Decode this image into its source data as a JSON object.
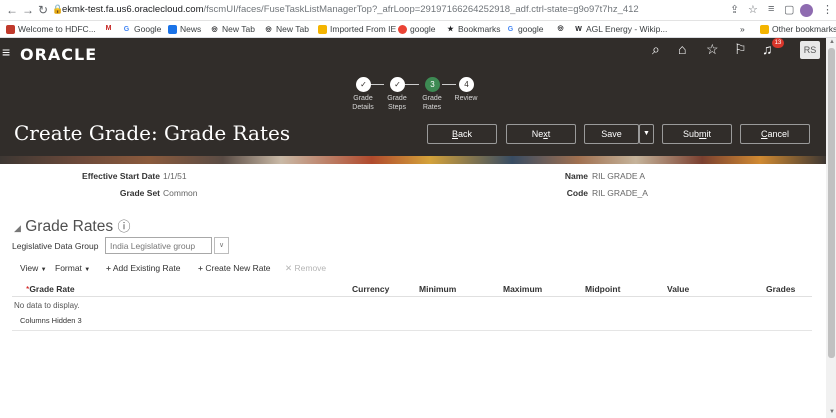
{
  "browser": {
    "url_host": "ekmk-test.fa.us6.oraclecloud.com",
    "url_path": "/fscmUI/faces/FuseTaskListManagerTop?_afrLoop=29197166264252918_adf.ctrl-state=g9o97t7hz_412",
    "bookmarks": [
      {
        "label": "Welcome to HDFC...",
        "icon_color": "#c0392b",
        "glyph": "■"
      },
      {
        "label": "",
        "icon_color": "#c5221f",
        "glyph": "M"
      },
      {
        "label": "Google",
        "icon_color": "#4285f4",
        "glyph": "G"
      },
      {
        "label": "News",
        "icon_color": "#1a73e8",
        "glyph": "▤"
      },
      {
        "label": "New Tab",
        "icon_color": "#202124",
        "glyph": "◎"
      },
      {
        "label": "New Tab",
        "icon_color": "#202124",
        "glyph": "◎"
      },
      {
        "label": "Imported From IE",
        "icon_color": "#f4b400",
        "glyph": "▬"
      },
      {
        "label": "google",
        "icon_color": "#ea4335",
        "glyph": "●"
      },
      {
        "label": "Bookmarks",
        "icon_color": "#202124",
        "glyph": "★"
      },
      {
        "label": "google",
        "icon_color": "#4285f4",
        "glyph": "G"
      },
      {
        "label": "",
        "icon_color": "#202124",
        "glyph": "◎"
      },
      {
        "label": "AGL Energy - Wikip...",
        "icon_color": "#202124",
        "glyph": "W"
      }
    ],
    "bookmarks_overflow": "»",
    "other_bookmarks": "Other bookmarks"
  },
  "header": {
    "logo": "ORACLE",
    "avatar": "RS",
    "notification_count": "13",
    "page_title": "Create Grade: Grade Rates",
    "train": [
      {
        "label_line1": "Grade",
        "label_line2": "Details",
        "state": "done",
        "mark": "✓"
      },
      {
        "label_line1": "Grade",
        "label_line2": "Steps",
        "state": "done",
        "mark": "✓"
      },
      {
        "label_line1": "Grade",
        "label_line2": "Rates",
        "state": "current",
        "mark": "3"
      },
      {
        "label_line1": "Review",
        "label_line2": "",
        "state": "todo",
        "mark": "4"
      }
    ],
    "buttons": {
      "back_pre": "",
      "back_ul": "B",
      "back_post": "ack",
      "next_pre": "Ne",
      "next_ul": "x",
      "next_post": "t",
      "save": "Save",
      "submit_pre": "Sub",
      "submit_ul": "m",
      "submit_post": "it",
      "cancel_pre": "",
      "cancel_ul": "C",
      "cancel_post": "ancel"
    }
  },
  "details": {
    "effective_start_date_label": "Effective Start Date",
    "effective_start_date_value": "1/1/51",
    "grade_set_label": "Grade Set",
    "grade_set_value": "Common",
    "name_label": "Name",
    "name_value": "RIL GRADE A",
    "code_label": "Code",
    "code_value": "RIL GRADE_A"
  },
  "section": {
    "title": "Grade Rates",
    "ldg_label": "Legislative Data Group",
    "ldg_value": "India Legislative group"
  },
  "toolbar": {
    "view": "View",
    "format": "Format",
    "add_existing": "Add Existing Rate",
    "create_new": "Create New Rate",
    "remove": "Remove"
  },
  "table": {
    "columns": [
      "Grade Rate",
      "Currency",
      "Minimum",
      "Maximum",
      "Midpoint",
      "Value",
      "Grades"
    ],
    "required_marker": "*",
    "no_data": "No data to display.",
    "columns_hidden": "Columns Hidden",
    "columns_hidden_count": "3"
  }
}
